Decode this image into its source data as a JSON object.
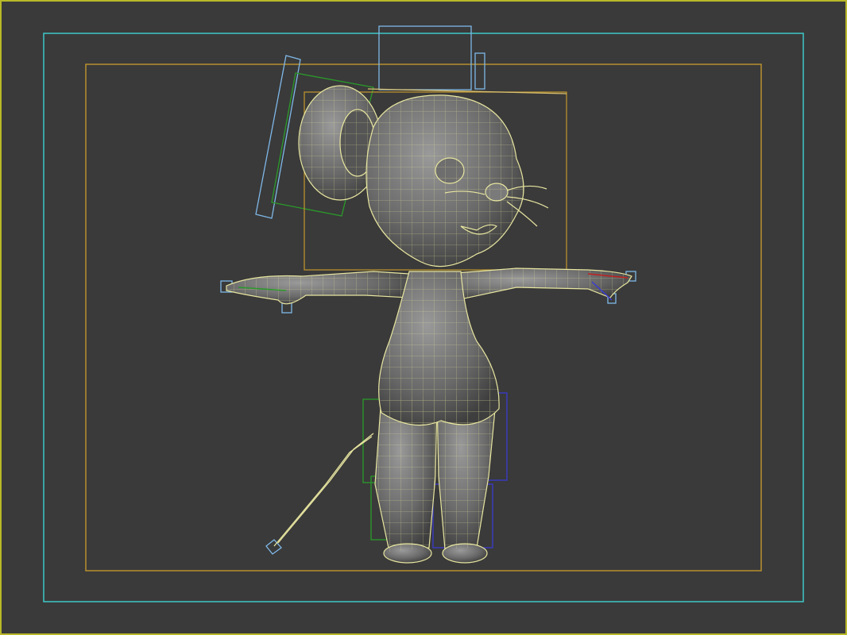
{
  "viewport": {
    "background_color": "#3a3a3a",
    "active_border_color": "#b8b828",
    "safe_frame_outer_color": "#3ec8c8",
    "safe_frame_inner_color": "#b8902e",
    "wireframe_color": "#e8e6a0",
    "model": "cartoon-mouse-character",
    "rig_colors": {
      "bone_cyan": "#7fb8e8",
      "bone_green": "#2a9a2a",
      "bone_blue": "#3b3bd0",
      "bone_red": "#c02020"
    }
  }
}
